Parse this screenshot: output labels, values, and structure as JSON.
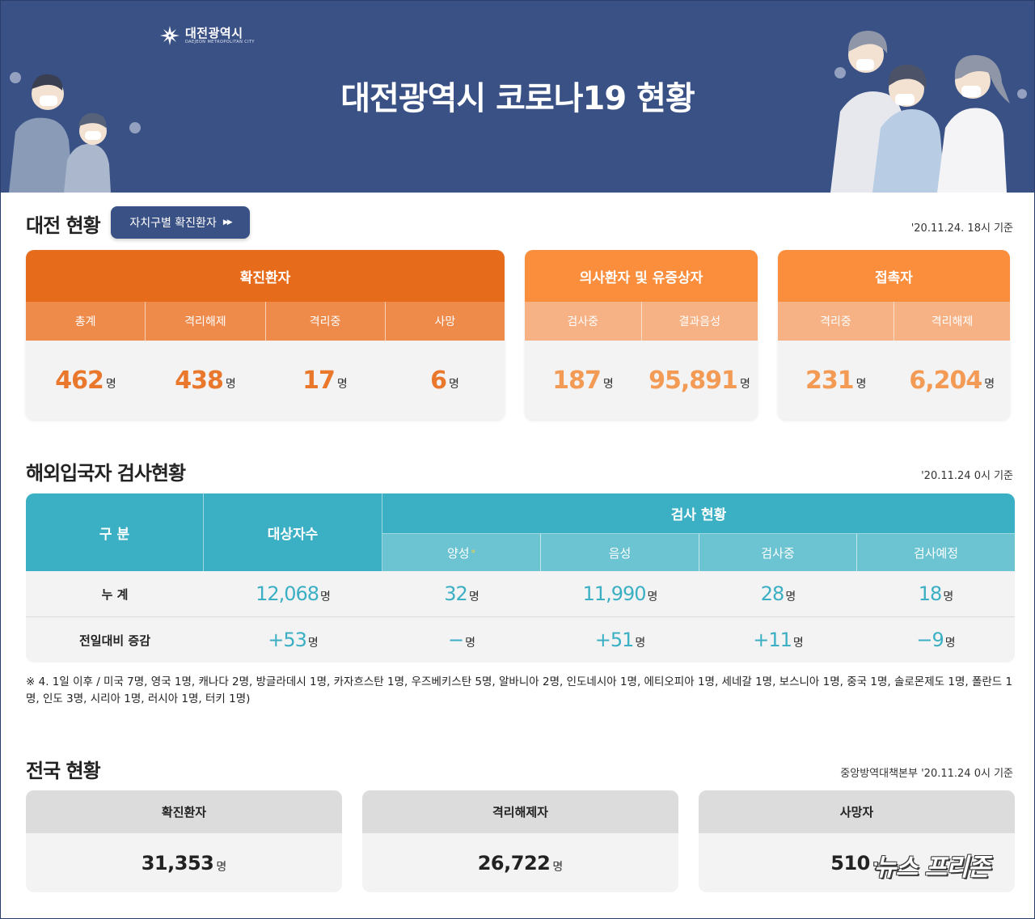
{
  "header": {
    "logo_name": "대전광역시",
    "logo_sub": "DAEJEON METROPOLITAN CITY",
    "title": "대전광역시 코로나19 현황"
  },
  "daejeon": {
    "title": "대전 현황",
    "button_label": "자치구별 확진환자",
    "asof": "'20.11.24. 18시 기준",
    "confirmed": {
      "title": "확진환자",
      "labels": [
        "총계",
        "격리해제",
        "격리중",
        "사망"
      ],
      "values": [
        "462",
        "438",
        "17",
        "6"
      ]
    },
    "suspected": {
      "title": "의사환자 및 유증상자",
      "labels": [
        "검사중",
        "결과음성"
      ],
      "values": [
        "187",
        "95,891"
      ]
    },
    "contacts": {
      "title": "접촉자",
      "labels": [
        "격리중",
        "격리해제"
      ],
      "values": [
        "231",
        "6,204"
      ]
    },
    "unit": "명"
  },
  "overseas": {
    "title": "해외입국자 검사현황",
    "asof": "'20.11.24 0시 기준",
    "col_category": "구 분",
    "col_targets": "대상자수",
    "group_label": "검사 현황",
    "sub_labels": [
      "양성",
      "음성",
      "검사중",
      "검사예정"
    ],
    "star": "*",
    "rows": [
      {
        "label": "누 계",
        "values": [
          "12,068",
          "32",
          "11,990",
          "28",
          "18"
        ]
      },
      {
        "label": "전일대비 증감",
        "values": [
          "+53",
          "−",
          "+51",
          "+11",
          "−9"
        ]
      }
    ],
    "unit": "명",
    "footnote": "※ 4. 1일 이후 / 미국 7명, 영국 1명, 캐나다 2명, 방글라데시 1명, 카자흐스탄 1명, 우즈베키스탄 5명, 알바니아 2명, 인도네시아 1명, 에티오피아 1명, 세네갈 1명, 보스니아 1명, 중국 1명, 솔로몬제도 1명, 폴란드 1명, 인도 3명, 시리아 1명, 러시아 1명, 터키 1명)"
  },
  "national": {
    "title": "전국 현황",
    "asof": "중앙방역대책본부 '20.11.24 0시 기준",
    "cards": [
      {
        "label": "확진환자",
        "value": "31,353"
      },
      {
        "label": "격리해제자",
        "value": "26,722"
      },
      {
        "label": "사망자",
        "value": "510"
      }
    ],
    "unit": "명"
  },
  "watermark": "뉴스 프리존",
  "colors": {
    "navy": "#3a5185",
    "orange_dark": "#e66c1c",
    "orange": "#fa8e3c",
    "teal": "#3bafc4",
    "teal_light": "#6cc4d2"
  }
}
